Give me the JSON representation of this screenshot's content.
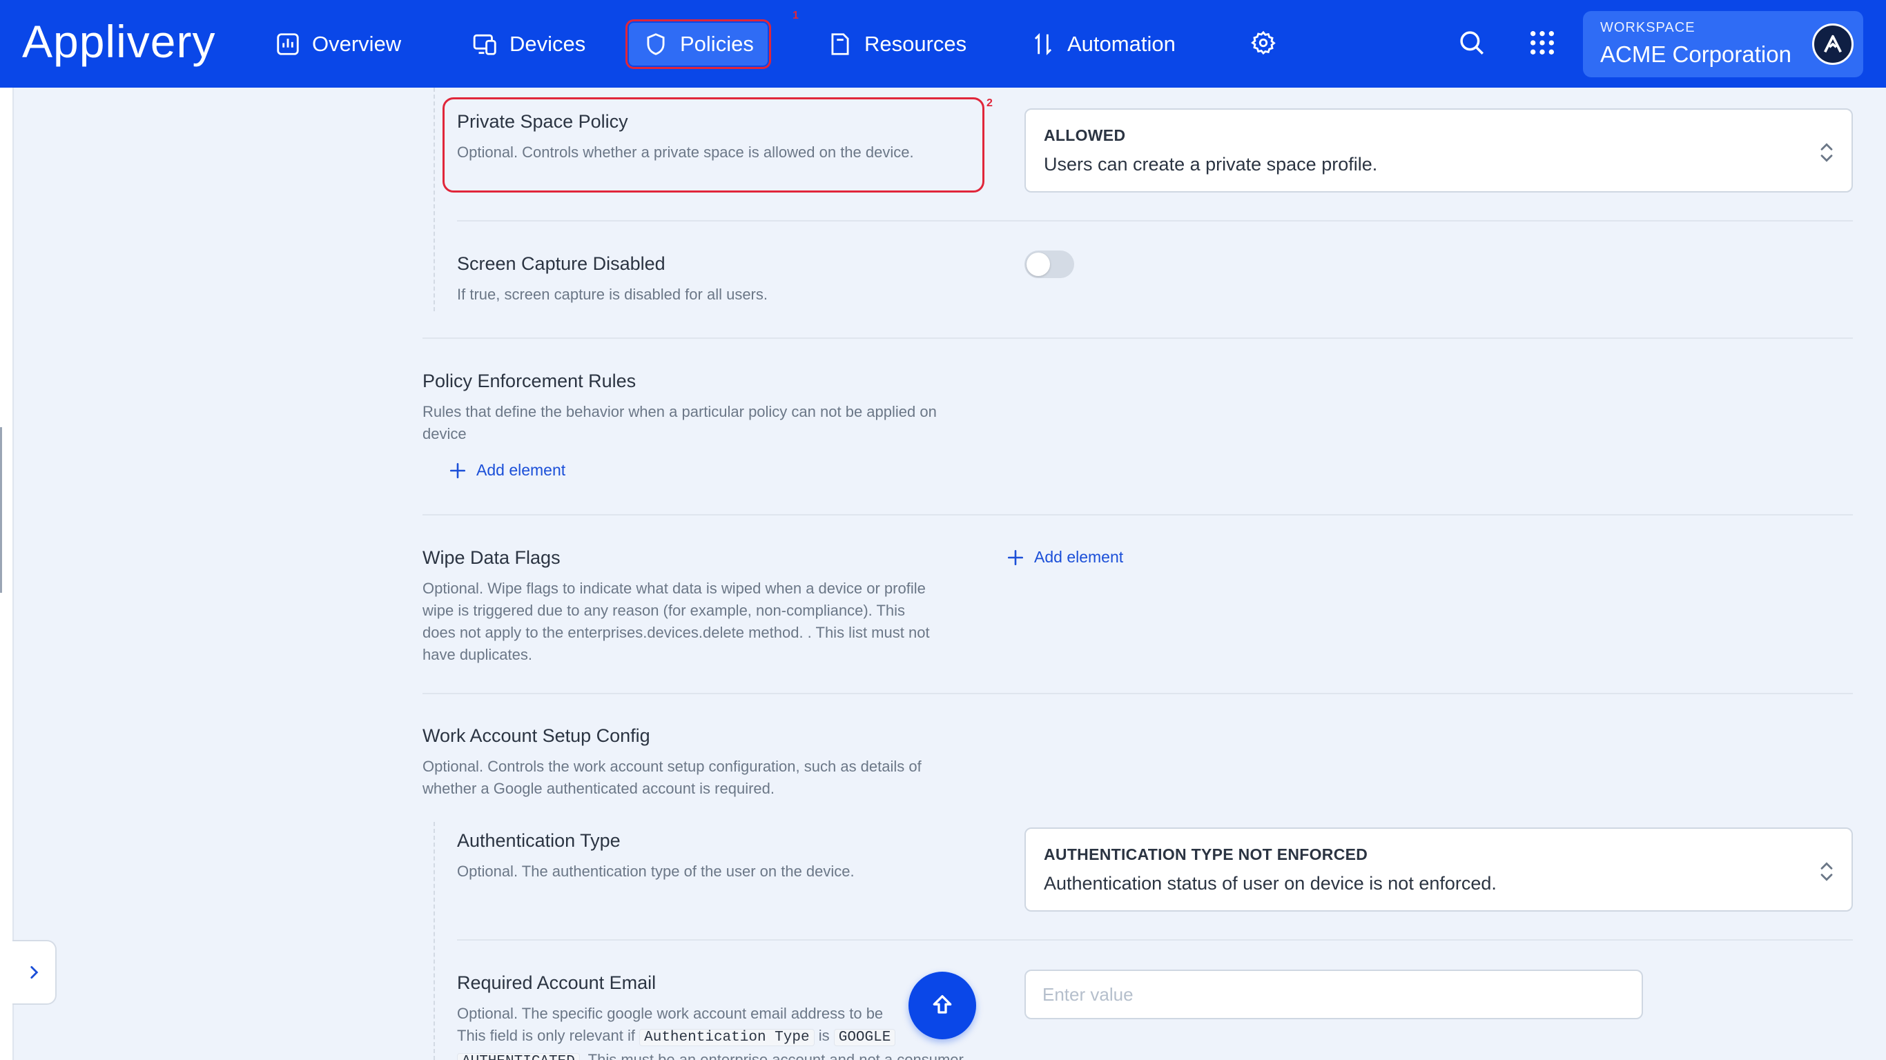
{
  "brand": {
    "name": "Applivery"
  },
  "nav": {
    "overview": "Overview",
    "devices": "Devices",
    "policies": "Policies",
    "policies_badge": "1",
    "resources": "Resources",
    "automation": "Automation"
  },
  "workspace": {
    "label": "WORKSPACE",
    "name": "ACME Corporation",
    "avatar_initial": "A"
  },
  "fields": {
    "private_space": {
      "title": "Private Space Policy",
      "badge": "2",
      "description": "Optional. Controls whether a private space is allowed on the device.",
      "select_label": "ALLOWED",
      "select_value": "Users can create a private space profile."
    },
    "screen_capture": {
      "title": "Screen Capture Disabled",
      "description": "If true, screen capture is disabled for all users.",
      "enabled": false
    },
    "enforcement_rules": {
      "title": "Policy Enforcement Rules",
      "description_line1": "Rules that define the behavior when a particular policy can not be applied on",
      "description_line2": "device",
      "add_label": "Add element"
    },
    "wipe_flags": {
      "title": "Wipe Data Flags",
      "description_line1": "Optional. Wipe flags to indicate what data is wiped when a device or profile",
      "description_line2": "wipe is triggered due to any reason (for example, non-compliance). This",
      "description_line3": "does not apply to the enterprises.devices.delete method. . This list must not",
      "description_line4": "have duplicates.",
      "add_label": "Add element"
    },
    "work_account": {
      "title": "Work Account Setup Config",
      "description_line1": "Optional. Controls the work account setup configuration, such as details of",
      "description_line2": "whether a Google authenticated account is required."
    },
    "auth_type": {
      "title": "Authentication Type",
      "description": "Optional. The authentication type of the user on the device.",
      "select_label": "AUTHENTICATION TYPE NOT ENFORCED",
      "select_value": "Authentication status of user on device is not enforced."
    },
    "required_email": {
      "title": "Required Account Email",
      "description_line1": "Optional. The specific google work account email address to be",
      "desc2_prefix": "This field is only relevant if",
      "desc2_code1": "Authentication Type",
      "desc2_mid": "is",
      "desc2_code2": "GOOGLE",
      "desc3_code": "AUTHENTICATED",
      "desc3_suffix": ". This must be an enterprise account and not a consumer",
      "placeholder": "Enter value"
    }
  },
  "colors": {
    "primary": "#0a47e8",
    "highlight": "#e0263a",
    "link": "#1b4fd8"
  },
  "icons": [
    "overview-icon",
    "devices-icon",
    "shield-icon",
    "resources-icon",
    "automation-icon",
    "gear-icon",
    "search-icon",
    "apps-grid-icon",
    "chevron-updown-icon",
    "plus-icon",
    "arrow-up-icon",
    "chevron-right-icon"
  ]
}
